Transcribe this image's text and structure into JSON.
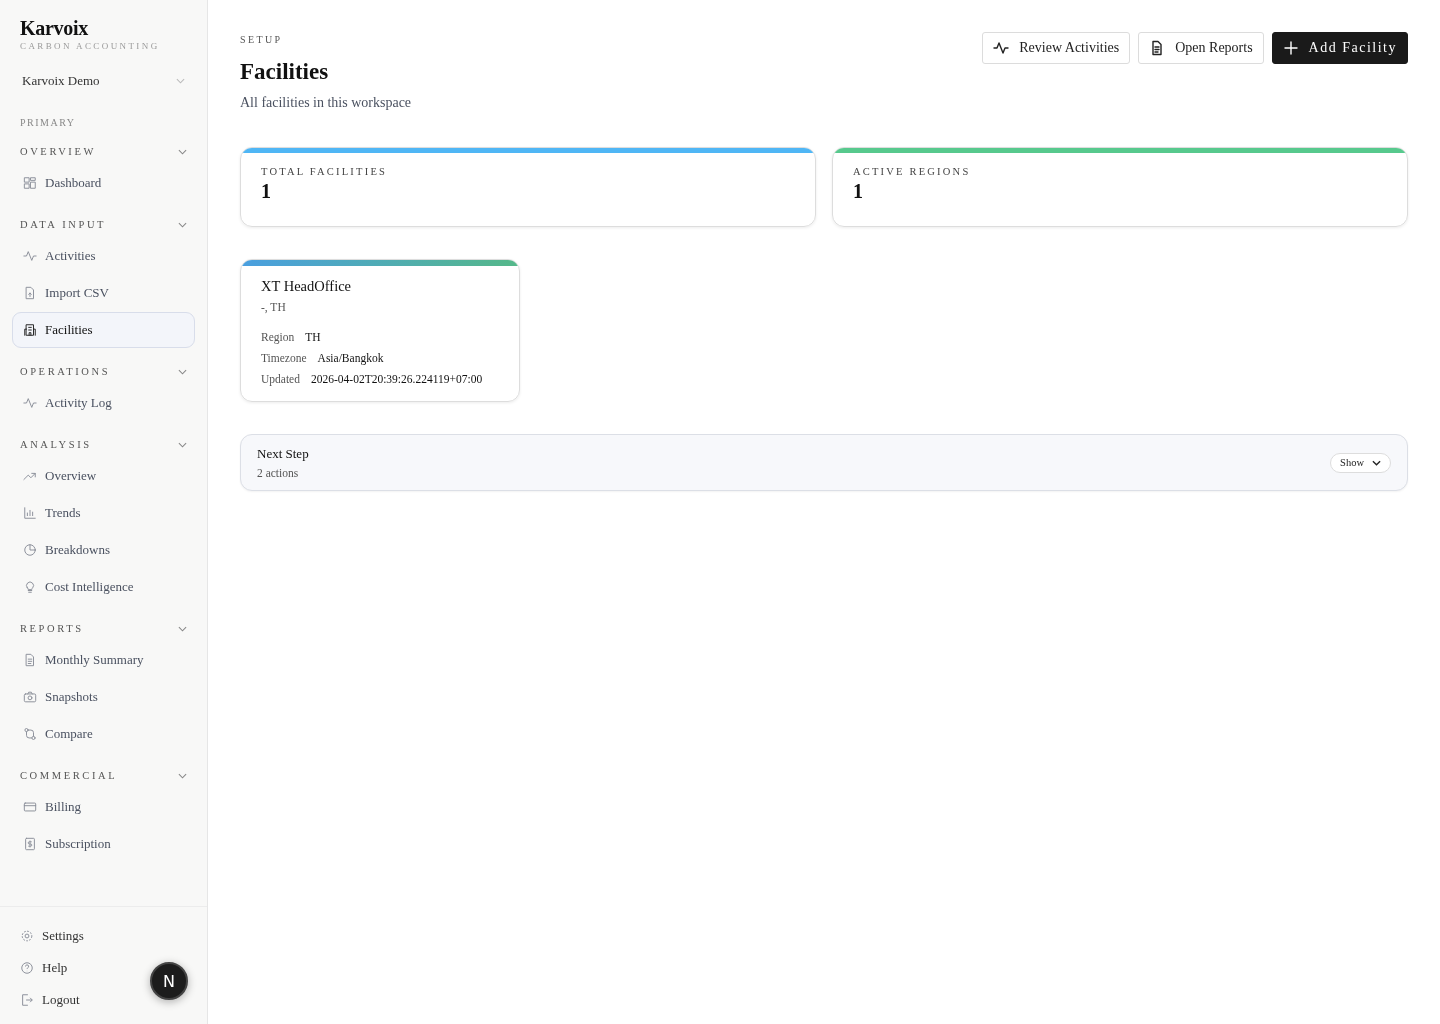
{
  "brand": {
    "name": "Karvoix",
    "tagline": "CARBON ACCOUNTING"
  },
  "workspace": {
    "name": "Karvoix Demo"
  },
  "sidebar": {
    "primary_label": "PRIMARY",
    "groups": [
      {
        "title": "OVERVIEW",
        "expanded": true,
        "items": [
          {
            "label": "Dashboard",
            "selected": false
          }
        ]
      },
      {
        "title": "DATA INPUT",
        "expanded": true,
        "items": [
          {
            "label": "Activities",
            "selected": false
          },
          {
            "label": "Import CSV",
            "selected": false
          },
          {
            "label": "Facilities",
            "selected": true
          }
        ]
      },
      {
        "title": "OPERATIONS",
        "expanded": true,
        "items": [
          {
            "label": "Activity Log",
            "selected": false
          }
        ]
      },
      {
        "title": "ANALYSIS",
        "expanded": true,
        "items": [
          {
            "label": "Overview",
            "selected": false
          },
          {
            "label": "Trends",
            "selected": false
          },
          {
            "label": "Breakdowns",
            "selected": false
          },
          {
            "label": "Cost Intelligence",
            "selected": false
          }
        ]
      },
      {
        "title": "REPORTS",
        "expanded": true,
        "items": [
          {
            "label": "Monthly Summary",
            "selected": false
          },
          {
            "label": "Snapshots",
            "selected": false
          },
          {
            "label": "Compare",
            "selected": false
          }
        ]
      },
      {
        "title": "COMMERCIAL",
        "expanded": true,
        "items": [
          {
            "label": "Billing",
            "selected": false
          },
          {
            "label": "Subscription",
            "selected": false
          }
        ]
      }
    ],
    "footer": [
      "Settings",
      "Help",
      "Logout"
    ]
  },
  "floating_button": {
    "letter": "N"
  },
  "header": {
    "eyebrow": "SETUP",
    "title": "Facilities",
    "subtitle": "All facilities in this workspace",
    "buttons": [
      {
        "label": "Review Activities",
        "kind": "outline"
      },
      {
        "label": "Open Reports",
        "kind": "outline"
      },
      {
        "label": "Add Facility",
        "kind": "primary"
      }
    ]
  },
  "stats": [
    {
      "label": "TOTAL FACILITIES",
      "value": "1",
      "color": "#4fb6f5"
    },
    {
      "label": "ACTIVE REGIONS",
      "value": "1",
      "color": "#57c98d"
    }
  ],
  "facilities": [
    {
      "name": "XT HeadOffice",
      "location": "-, TH",
      "fields": [
        {
          "label": "Region",
          "value": "TH"
        },
        {
          "label": "Timezone",
          "value": "Asia/Bangkok"
        },
        {
          "label": "Updated",
          "value": "2026-04-02T20:39:26.224119+07:00"
        }
      ]
    }
  ],
  "next_step": {
    "title": "Next Step",
    "count": "2 actions",
    "toggle": "Show",
    "expanded": false
  }
}
